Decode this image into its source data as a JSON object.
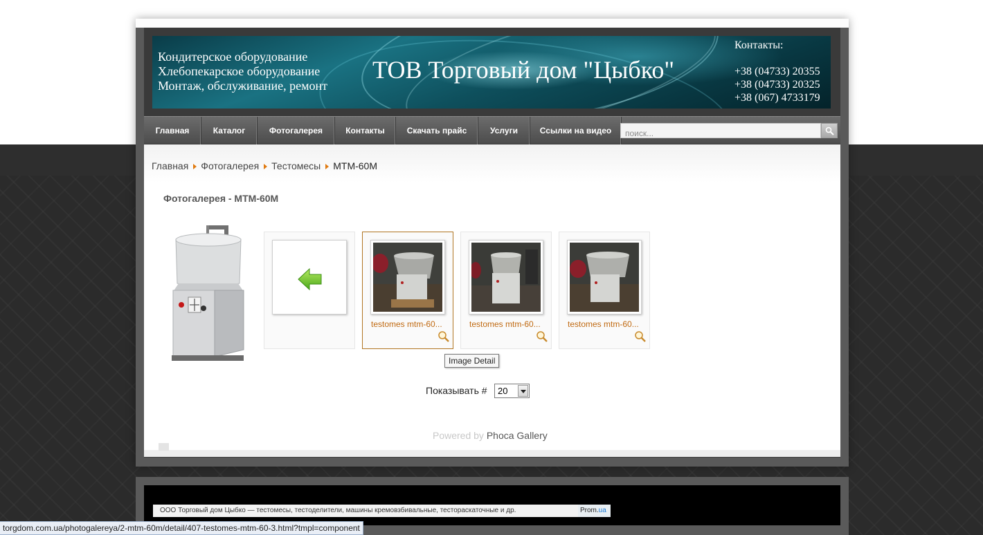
{
  "header": {
    "left_lines": [
      "Кондитерское оборудование",
      "Хлебопекарское оборудование",
      "Монтаж, обслуживание, ремонт"
    ],
    "title": "ТОВ Торговый дом \"Цыбко\"",
    "contacts_label": "Контакты:",
    "phones": [
      "+38 (04733) 20355",
      "+38 (04733) 20325",
      "+38 (067) 4733179"
    ]
  },
  "nav": {
    "items": [
      "Главная",
      "Каталог",
      "Фотогалерея",
      "Контакты",
      "Скачать прайс",
      "Услуги",
      "Ссылки на видео"
    ],
    "search_placeholder": "поиск..."
  },
  "breadcrumb": {
    "items": [
      "Главная",
      "Фотогалерея",
      "Тестомесы"
    ],
    "current": "МТМ-60М"
  },
  "gallery": {
    "heading": "Фотогалерея - МТМ-60М",
    "thumbs": [
      {
        "caption": ""
      },
      {
        "caption": "testomes mtm-60..."
      },
      {
        "caption": "testomes mtm-60..."
      },
      {
        "caption": "testomes mtm-60..."
      }
    ],
    "tooltip": "Image Detail"
  },
  "pagination": {
    "label": "Показывать #",
    "value": "20"
  },
  "powered": {
    "prefix": "Powered by",
    "brand": "Phoca Gallery"
  },
  "footer": {
    "text": "ООО Торговый дом Цыбко — тестомесы, тестоделители, машины кремовзбивальные, тестораскаточные и др.",
    "prom_main": "Prom.",
    "prom_suffix": "ua"
  },
  "status_bar": {
    "url": "torgdom.com.ua/photogalereya/2-mtm-60m/detail/407-testomes-mtm-60-3.html?tmpl=component"
  },
  "colors": {
    "accent_link": "#c06a12",
    "nav_bg": "#5c5c5c",
    "banner": "#1a7282"
  }
}
